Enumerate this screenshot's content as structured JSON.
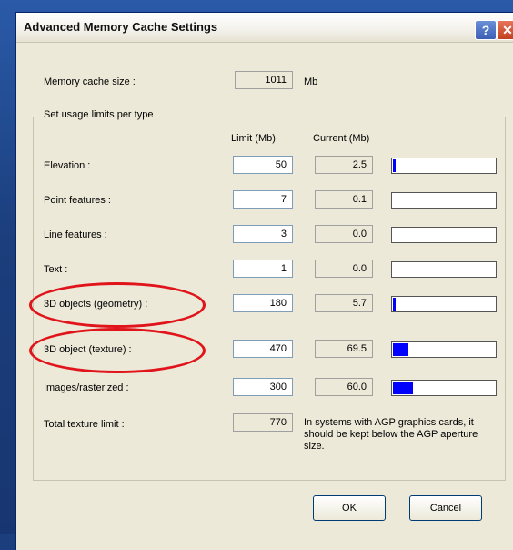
{
  "dialog": {
    "title": "Advanced Memory Cache Settings",
    "help_glyph": "?",
    "close_glyph": "✕"
  },
  "cache": {
    "label": "Memory cache size :",
    "value": "1011",
    "unit": "Mb"
  },
  "group": {
    "label": "Set usage limits per type",
    "col_limit": "Limit (Mb)",
    "col_current": "Current (Mb)"
  },
  "rows": [
    {
      "label": "Elevation :",
      "limit": "50",
      "current": "2.5",
      "usage_fraction": 0.03
    },
    {
      "label": "Point features :",
      "limit": "7",
      "current": "0.1",
      "usage_fraction": 0.0
    },
    {
      "label": "Line features :",
      "limit": "3",
      "current": "0.0",
      "usage_fraction": 0.0
    },
    {
      "label": "Text :",
      "limit": "1",
      "current": "0.0",
      "usage_fraction": 0.0
    },
    {
      "label": "3D objects (geometry) :",
      "limit": "180",
      "current": "5.7",
      "usage_fraction": 0.03
    },
    {
      "label": "3D object (texture) :",
      "limit": "470",
      "current": "69.5",
      "usage_fraction": 0.15
    },
    {
      "label": "Images/rasterized :",
      "limit": "300",
      "current": "60.0",
      "usage_fraction": 0.2
    }
  ],
  "total": {
    "label": "Total texture limit :",
    "value": "770",
    "note": "In systems with AGP graphics cards, it should be kept below the AGP aperture size."
  },
  "buttons": {
    "ok": "OK",
    "cancel": "Cancel"
  },
  "colors": {
    "highlight_oval": "#e0141a",
    "usage_fill": "#0000ff"
  }
}
